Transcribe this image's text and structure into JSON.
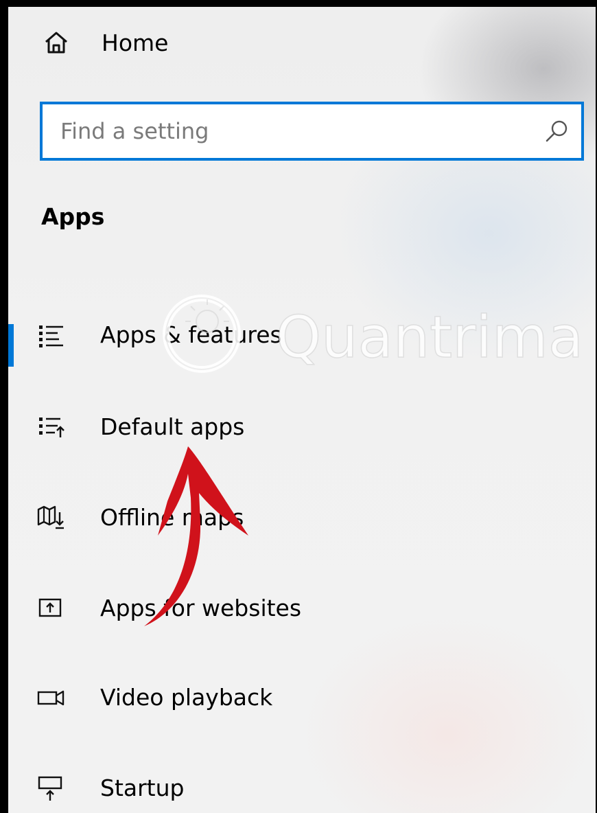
{
  "home": {
    "label": "Home",
    "icon": "home-icon"
  },
  "search": {
    "placeholder": "Find a setting",
    "value": "",
    "icon": "search-icon"
  },
  "section": {
    "title": "Apps"
  },
  "nav": {
    "items": [
      {
        "label": "Apps & features",
        "icon": "apps-features-icon",
        "selected": true
      },
      {
        "label": "Default apps",
        "icon": "default-apps-icon",
        "selected": false
      },
      {
        "label": "Offline maps",
        "icon": "offline-maps-icon",
        "selected": false
      },
      {
        "label": "Apps for websites",
        "icon": "apps-for-websites-icon",
        "selected": false
      },
      {
        "label": "Video playback",
        "icon": "video-playback-icon",
        "selected": false
      },
      {
        "label": "Startup",
        "icon": "startup-icon",
        "selected": false
      }
    ]
  },
  "watermark": {
    "text": "Quantrimang"
  },
  "colors": {
    "accent": "#0078d7",
    "annotation": "#d0121b",
    "background": "#f0f0f0"
  }
}
